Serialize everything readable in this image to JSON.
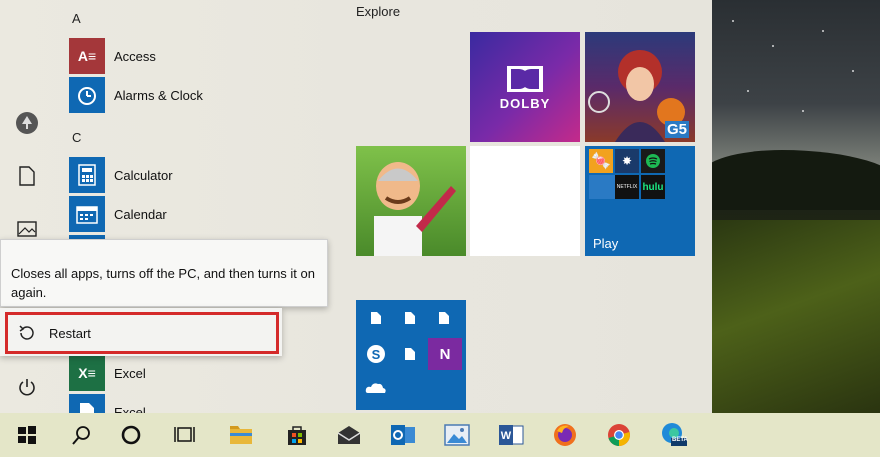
{
  "start_menu": {
    "letters": [
      "A",
      "C"
    ],
    "apps": [
      {
        "label": "Access",
        "icon": "access-icon",
        "color": "#a4373a",
        "glyph": "A≡"
      },
      {
        "label": "Alarms & Clock",
        "icon": "alarm-clock-icon",
        "color": "#0f68b3",
        "glyph": "⏰"
      },
      {
        "label": "Calculator",
        "icon": "calculator-icon",
        "color": "#0f68b3",
        "glyph": "▦"
      },
      {
        "label": "Calendar",
        "icon": "calendar-icon",
        "color": "#0f68b3",
        "glyph": "▤"
      },
      {
        "label": "Excel",
        "icon": "excel-icon",
        "color": "#1d7044",
        "glyph": "X≡"
      },
      {
        "label": "Excel",
        "icon": "excel-icon-2",
        "color": "#0f68b3",
        "glyph": "▯"
      }
    ]
  },
  "power_menu": {
    "tooltip": "Closes all apps, turns off the PC, and then turns it on again.",
    "restart_label": "Restart"
  },
  "tiles": {
    "group_title": "Explore",
    "dolby_label": "DOLBY",
    "g5_label": "G5",
    "play_label": "Play",
    "hulu_label": "hulu",
    "netflix_label": "NETFLIX"
  },
  "taskbar": {
    "items": [
      "start-icon",
      "search-icon",
      "cortana-icon",
      "task-view-icon",
      "file-explorer-icon",
      "store-icon",
      "mail-icon",
      "outlook-icon",
      "photos-icon",
      "word-icon",
      "firefox-icon",
      "chrome-icon",
      "edge-beta-icon"
    ],
    "edge_badge": "BETA"
  },
  "colors": {
    "accent": "#0f68b3",
    "restart_border": "#d42a2a",
    "taskbar": "#e4e6c8"
  }
}
